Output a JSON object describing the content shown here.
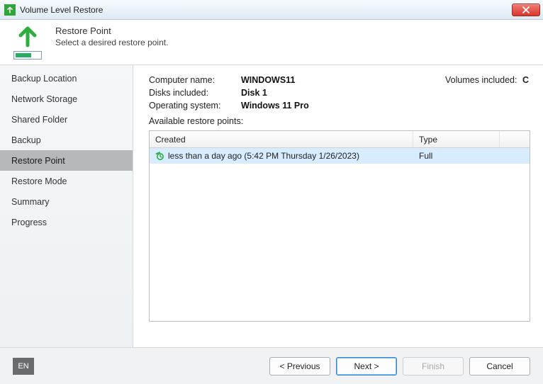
{
  "window": {
    "title": "Volume Level Restore"
  },
  "header": {
    "title": "Restore Point",
    "subtitle": "Select a desired restore point."
  },
  "sidebar": {
    "items": [
      "Backup Location",
      "Network Storage",
      "Shared Folder",
      "Backup",
      "Restore Point",
      "Restore Mode",
      "Summary",
      "Progress"
    ],
    "active_index": 4
  },
  "info": {
    "computer_name_label": "Computer name:",
    "computer_name": "WINDOWS11",
    "disks_label": "Disks included:",
    "disks": "Disk 1",
    "os_label": "Operating system:",
    "os": "Windows 11 Pro",
    "volumes_label": "Volumes included:",
    "volumes": "C",
    "available_label": "Available restore points:"
  },
  "grid": {
    "columns": {
      "created": "Created",
      "type": "Type"
    },
    "rows": [
      {
        "created": "less than a day ago (5:42 PM Thursday 1/26/2023)",
        "type": "Full"
      }
    ]
  },
  "footer": {
    "language": "EN",
    "previous": "< Previous",
    "next": "Next >",
    "finish": "Finish",
    "cancel": "Cancel"
  }
}
